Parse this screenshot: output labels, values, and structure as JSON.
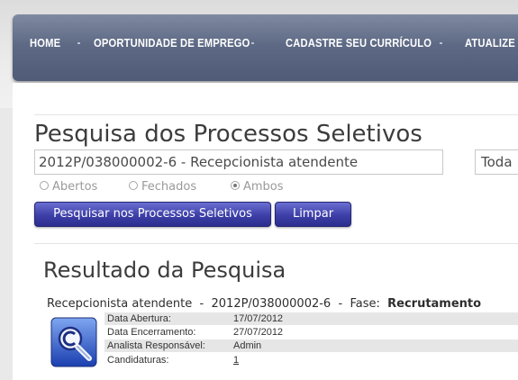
{
  "nav": {
    "items": [
      "HOME",
      "OPORTUNIDADE DE EMPREGO",
      "CADASTRE SEU CURRÍCULO",
      "ATUALIZE S"
    ]
  },
  "search": {
    "title": "Pesquisa dos Processos Seletivos",
    "query": "2012P/038000002-6 - Recepcionista atendente",
    "status_select": "Toda",
    "filters": [
      {
        "label": "Abertos",
        "selected": false
      },
      {
        "label": "Fechados",
        "selected": false
      },
      {
        "label": "Ambos",
        "selected": true
      }
    ],
    "search_button": "Pesquisar nos Processos Seletivos",
    "clear_button": "Limpar"
  },
  "results": {
    "title": "Resultado da Pesquisa",
    "job_title": "Recepcionista atendente",
    "separator": "-",
    "process_code": "2012P/038000002-6",
    "phase_label": "Fase:",
    "phase_value": "Recrutamento",
    "icon": "search-copyright-icon",
    "details": [
      {
        "label": "Data Abertura:",
        "value": "17/07/2012"
      },
      {
        "label": "Data Encerramento:",
        "value": "27/07/2012"
      },
      {
        "label": "Analista Responsável:",
        "value": "Admin"
      },
      {
        "label": "Candidaturas:",
        "value": "1"
      }
    ]
  },
  "colors": {
    "nav_bg": "#5e6a85",
    "button_bg": "#3d3fa8",
    "text": "#3c3c3c"
  }
}
